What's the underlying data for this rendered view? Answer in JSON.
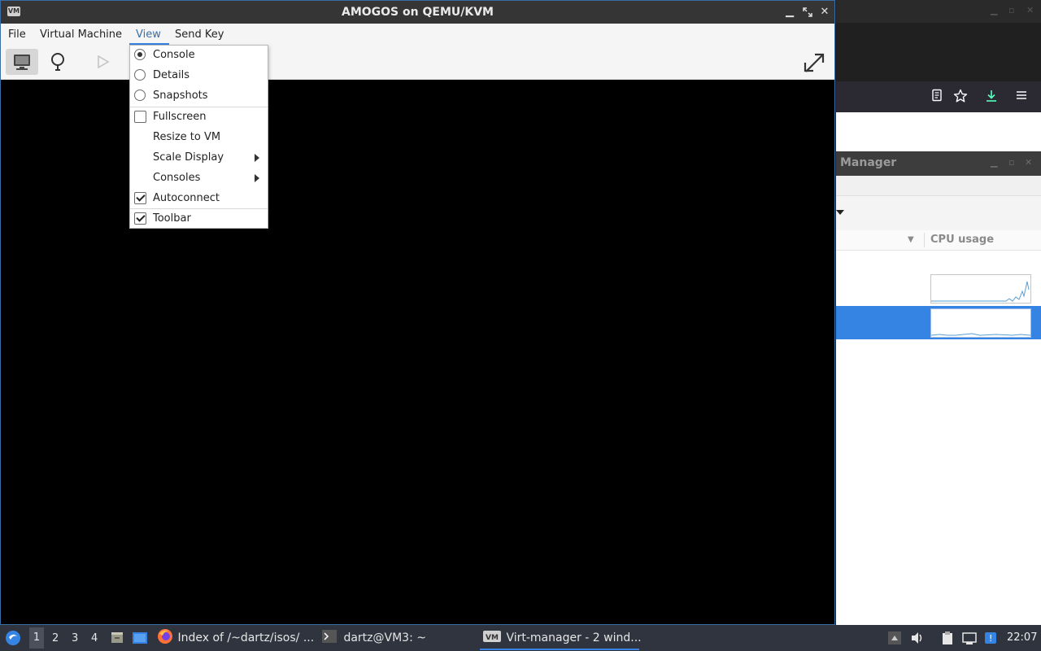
{
  "window": {
    "title": "AMOGOS on QEMU/KVM",
    "icon_label": "VM"
  },
  "menubar": {
    "file": "File",
    "virtual_machine": "Virtual Machine",
    "view": "View",
    "send_key": "Send Key"
  },
  "view_menu": {
    "items": [
      {
        "label": "Console",
        "type": "radio",
        "checked": true
      },
      {
        "label": "Details",
        "type": "radio",
        "checked": false
      },
      {
        "label": "Snapshots",
        "type": "radio",
        "checked": false
      },
      {
        "label": "Fullscreen",
        "type": "check",
        "checked": false
      },
      {
        "label": "Resize to VM",
        "type": "plain"
      },
      {
        "label": "Scale Display",
        "type": "submenu"
      },
      {
        "label": "Consoles",
        "type": "submenu"
      },
      {
        "label": "Autoconnect",
        "type": "check",
        "checked": true
      },
      {
        "label": "Toolbar",
        "type": "check",
        "checked": true
      }
    ]
  },
  "background": {
    "manager_title": "Manager",
    "cpu_usage_header": "CPU usage"
  },
  "taskbar": {
    "workspaces": [
      "1",
      "2",
      "3",
      "4"
    ],
    "tasks": [
      {
        "label": "Index of /~dartz/isos/ ..."
      },
      {
        "label": "dartz@VM3: ~"
      },
      {
        "label": "Virt-manager - 2 wind..."
      }
    ],
    "clock": "22:07"
  },
  "colors": {
    "accent": "#3584e4",
    "taskbar": "#2f343f",
    "titlebar": "#353535"
  }
}
